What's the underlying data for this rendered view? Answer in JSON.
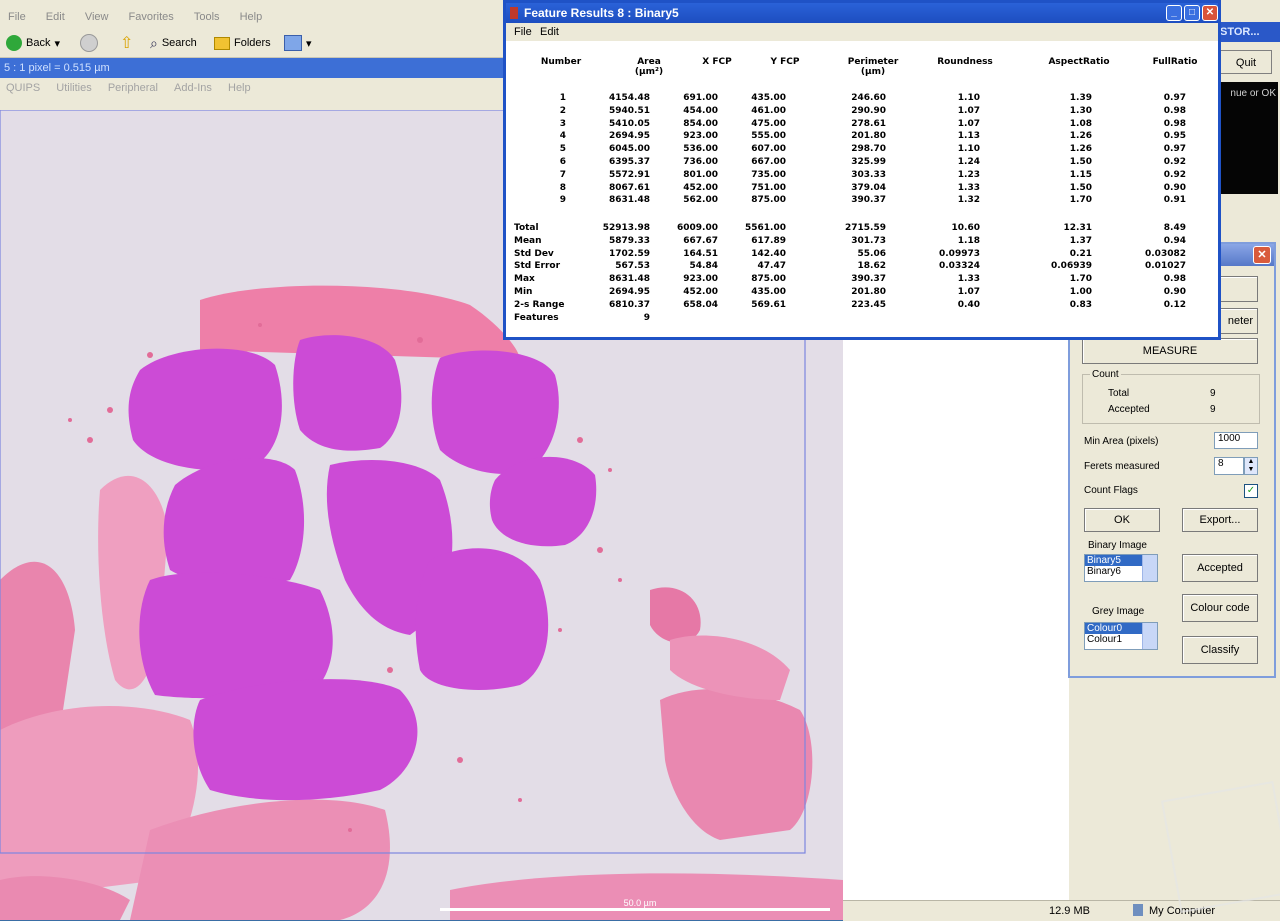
{
  "explorer": {
    "menu": [
      "File",
      "Edit",
      "View",
      "Favorites",
      "Tools",
      "Help"
    ],
    "toolbar": {
      "back": "Back",
      "search": "Search",
      "folders": "Folders"
    }
  },
  "image_window": {
    "title": "5  :  1 pixel = 0.515 µm",
    "menu": [
      "QUIPS",
      "Utilities",
      "Peripheral",
      "Add-Ins",
      "Help"
    ],
    "scale_bar": "50.0 µm"
  },
  "feature_results": {
    "title": "Feature Results 8 : Binary5",
    "menu": [
      "File",
      "Edit"
    ],
    "headers": [
      {
        "key": "number",
        "label": "Number",
        "unit": ""
      },
      {
        "key": "area",
        "label": "Area",
        "unit": "(µm²)"
      },
      {
        "key": "xfcp",
        "label": "X FCP",
        "unit": ""
      },
      {
        "key": "yfcp",
        "label": "Y FCP",
        "unit": ""
      },
      {
        "key": "perimeter",
        "label": "Perimeter",
        "unit": "(µm)"
      },
      {
        "key": "roundness",
        "label": "Roundness",
        "unit": ""
      },
      {
        "key": "aspect",
        "label": "AspectRatio",
        "unit": ""
      },
      {
        "key": "full",
        "label": "FullRatio",
        "unit": ""
      }
    ],
    "rows": [
      [
        "1",
        "4154.48",
        "691.00",
        "435.00",
        "246.60",
        "1.10",
        "1.39",
        "0.97"
      ],
      [
        "2",
        "5940.51",
        "454.00",
        "461.00",
        "290.90",
        "1.07",
        "1.30",
        "0.98"
      ],
      [
        "3",
        "5410.05",
        "854.00",
        "475.00",
        "278.61",
        "1.07",
        "1.08",
        "0.98"
      ],
      [
        "4",
        "2694.95",
        "923.00",
        "555.00",
        "201.80",
        "1.13",
        "1.26",
        "0.95"
      ],
      [
        "5",
        "6045.00",
        "536.00",
        "607.00",
        "298.70",
        "1.10",
        "1.26",
        "0.97"
      ],
      [
        "6",
        "6395.37",
        "736.00",
        "667.00",
        "325.99",
        "1.24",
        "1.50",
        "0.92"
      ],
      [
        "7",
        "5572.91",
        "801.00",
        "735.00",
        "303.33",
        "1.23",
        "1.15",
        "0.92"
      ],
      [
        "8",
        "8067.61",
        "452.00",
        "751.00",
        "379.04",
        "1.33",
        "1.50",
        "0.90"
      ],
      [
        "9",
        "8631.48",
        "562.00",
        "875.00",
        "390.37",
        "1.32",
        "1.70",
        "0.91"
      ]
    ],
    "stats": [
      [
        "Total",
        "52913.98",
        "6009.00",
        "5561.00",
        "2715.59",
        "10.60",
        "12.31",
        "8.49"
      ],
      [
        "Mean",
        "5879.33",
        "667.67",
        "617.89",
        "301.73",
        "1.18",
        "1.37",
        "0.94"
      ],
      [
        "Std Dev",
        "1702.59",
        "164.51",
        "142.40",
        "55.06",
        "0.09973",
        "0.21",
        "0.03082"
      ],
      [
        "Std Error",
        "567.53",
        "54.84",
        "47.47",
        "18.62",
        "0.03324",
        "0.06939",
        "0.01027"
      ],
      [
        "Max",
        "8631.48",
        "923.00",
        "875.00",
        "390.37",
        "1.33",
        "1.70",
        "0.98"
      ],
      [
        "Min",
        "2694.95",
        "452.00",
        "435.00",
        "201.80",
        "1.07",
        "1.00",
        "0.90"
      ],
      [
        "2-s Range",
        "6810.37",
        "658.04",
        "569.61",
        "223.45",
        "0.40",
        "0.83",
        "0.12"
      ],
      [
        "Features",
        "9",
        "",
        "",
        "",
        "",
        "",
        ""
      ]
    ]
  },
  "top_right": {
    "title": "STOR...",
    "quit": "Quit",
    "log": "nue or OK"
  },
  "count_panel": {
    "partial_button": "neter",
    "measure": "MEASURE",
    "count_group": "Count",
    "total_label": "Total",
    "total_value": "9",
    "accepted_label": "Accepted",
    "accepted_value": "9",
    "min_area_label": "Min Area (pixels)",
    "min_area_value": "1000",
    "ferets_label": "Ferets measured",
    "ferets_value": "8",
    "count_flags_label": "Count Flags",
    "count_flags_check": "✓",
    "ok": "OK",
    "export": "Export...",
    "binary_label": "Binary Image",
    "binary_options": [
      "Binary5",
      "Binary6"
    ],
    "accepted_btn": "Accepted",
    "colour_code": "Colour code",
    "grey_label": "Grey Image",
    "grey_options": [
      "Colour0",
      "Colour1"
    ],
    "classify": "Classify"
  },
  "statusbar": {
    "size": "12.9 MB",
    "zone": "My Computer"
  }
}
